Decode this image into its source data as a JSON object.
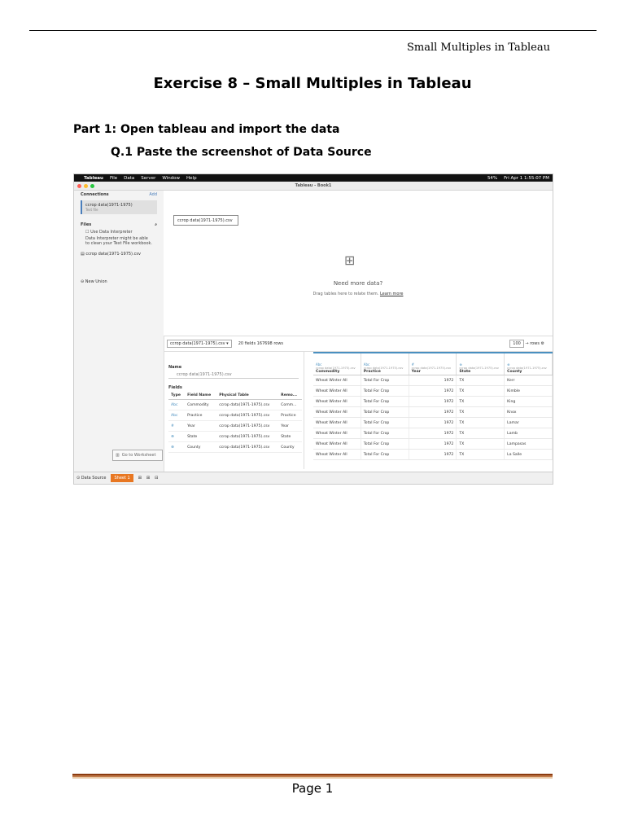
{
  "header": {
    "running_title": "Small Multiples in Tableau"
  },
  "document": {
    "title": "Exercise 8 – Small Multiples in Tableau",
    "part_heading": "Part 1: Open tableau and import the data",
    "question": "Q.1 Paste the screenshot of Data Source"
  },
  "footer": {
    "page": "Page 1"
  },
  "screenshot": {
    "menubar": {
      "apple": "",
      "app": "Tableau",
      "menus": [
        "File",
        "Data",
        "Server",
        "Window",
        "Help"
      ],
      "battery": "54%",
      "clock": "Fri Apr 1 1:55:07 PM"
    },
    "window_title": "Tableau - Book1",
    "sidebar": {
      "connections_label": "Connections",
      "add_label": "Add",
      "connection_name": "ccrop data(1971-1975)",
      "connection_type": "Text file",
      "files_label": "Files",
      "interpreter_label": "Use Data Interpreter",
      "interpreter_note": "Data Interpreter might be able to clean your Text File workbook.",
      "file_item": "ccrop data(1971-1975).csv",
      "new_union": "New Union"
    },
    "canvas": {
      "table_name": "ccrop data(1971-1975).csv",
      "need_more": "Need more data?",
      "drag_text": "Drag tables here to relate them.",
      "learn_more": "Learn more"
    },
    "toolbar": {
      "table_select": "ccrop data(1971-1975).csv",
      "summary": "20 fields 167698 rows",
      "rows_value": "100",
      "rows_label": "rows"
    },
    "meta": {
      "name_label": "Name",
      "name_value": "ccrop data(1971-1975).csv",
      "fields_label": "Fields",
      "columns": [
        "Type",
        "Field Name",
        "Physical Table",
        "Remo..."
      ],
      "rows": [
        [
          "Abc",
          "Commodity",
          "ccrop data(1971-1975).csv",
          "Comm..."
        ],
        [
          "Abc",
          "Practice",
          "ccrop data(1971-1975).csv",
          "Practice"
        ],
        [
          "#",
          "Year",
          "ccrop data(1971-1975).csv",
          "Year"
        ],
        [
          "⊕",
          "State",
          "ccrop data(1971-1975).csv",
          "State"
        ],
        [
          "⊕",
          "County",
          "ccrop data(1971-1975).csv",
          "County"
        ]
      ]
    },
    "grid": {
      "columns": [
        {
          "icon": "Abc",
          "source": "ccrop data(1971-1975).csv",
          "name": "Commodity"
        },
        {
          "icon": "Abc",
          "source": "ccrop data(1971-1975).csv",
          "name": "Practice"
        },
        {
          "icon": "#",
          "source": "ccrop data(1971-1975).csv",
          "name": "Year"
        },
        {
          "icon": "⊕",
          "source": "ccrop data(1971-1975).csv",
          "name": "State"
        },
        {
          "icon": "⊕",
          "source": "ccrop data(1971-1975).csv",
          "name": "County"
        }
      ],
      "rows": [
        [
          "Wheat Winter All",
          "Total For Crop",
          "1972",
          "TX",
          "Kerr"
        ],
        [
          "Wheat Winter All",
          "Total For Crop",
          "1972",
          "TX",
          "Kimble"
        ],
        [
          "Wheat Winter All",
          "Total For Crop",
          "1972",
          "TX",
          "King"
        ],
        [
          "Wheat Winter All",
          "Total For Crop",
          "1972",
          "TX",
          "Knox"
        ],
        [
          "Wheat Winter All",
          "Total For Crop",
          "1972",
          "TX",
          "Lamar"
        ],
        [
          "Wheat Winter All",
          "Total For Crop",
          "1972",
          "TX",
          "Lamb"
        ],
        [
          "Wheat Winter All",
          "Total For Crop",
          "1972",
          "TX",
          "Lampasas"
        ],
        [
          "Wheat Winter All",
          "Total For Crop",
          "1972",
          "TX",
          "La Salle"
        ]
      ]
    },
    "goto_worksheet": "Go to Worksheet",
    "tabs": {
      "data_source": "Data Source",
      "sheet": "Sheet 1"
    }
  }
}
